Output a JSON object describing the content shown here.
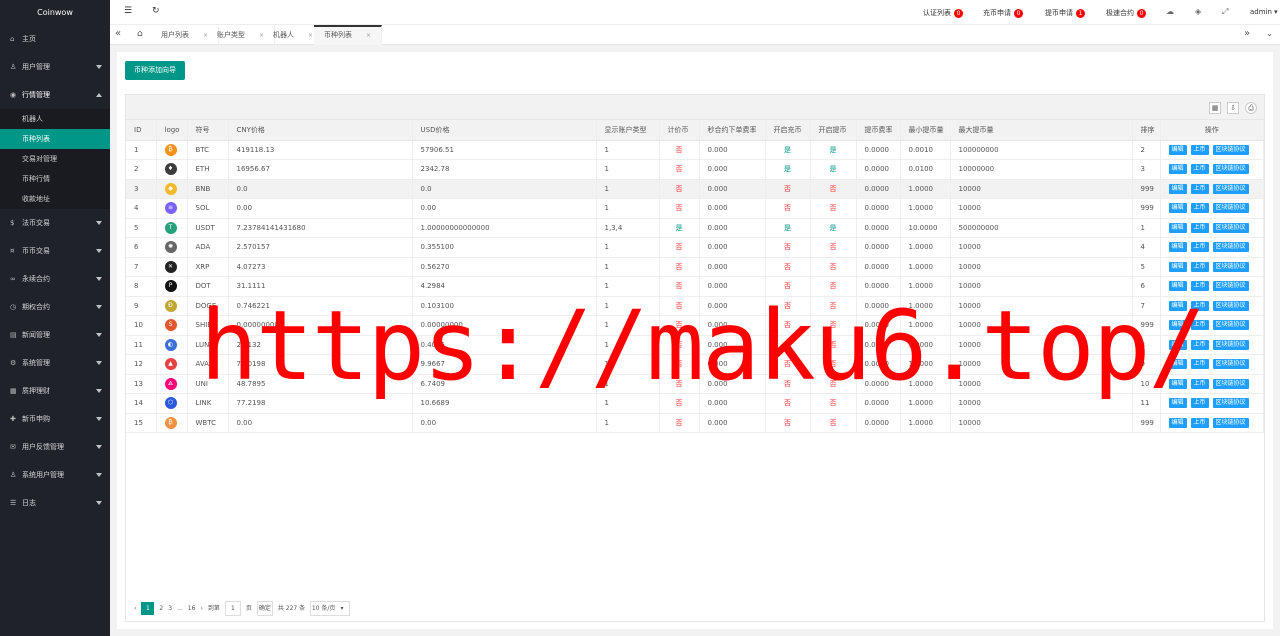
{
  "app": {
    "title": "Coinwow"
  },
  "sidebar": {
    "items": [
      {
        "icon": "home-icon",
        "glyph": "⌂",
        "label": "主页",
        "caret": false
      },
      {
        "icon": "user-icon",
        "glyph": "♙",
        "label": "用户管理",
        "caret": true
      },
      {
        "icon": "market-icon",
        "glyph": "◉",
        "label": "行情管理",
        "caret": true,
        "open": true
      },
      {
        "icon": "fiat-icon",
        "glyph": "$",
        "label": "法币交易",
        "caret": true
      },
      {
        "icon": "coin-trade-icon",
        "glyph": "¤",
        "label": "币币交易",
        "caret": true
      },
      {
        "icon": "perpetual-icon",
        "glyph": "∞",
        "label": "永续合约",
        "caret": true
      },
      {
        "icon": "options-icon",
        "glyph": "◷",
        "label": "期权合约",
        "caret": true
      },
      {
        "icon": "news-icon",
        "glyph": "▤",
        "label": "新闻管理",
        "caret": true
      },
      {
        "icon": "gear-icon",
        "glyph": "⚙",
        "label": "系统管理",
        "caret": true
      },
      {
        "icon": "finance-icon",
        "glyph": "▦",
        "label": "质押理财",
        "caret": true
      },
      {
        "icon": "subscribe-icon",
        "glyph": "✚",
        "label": "新币申购",
        "caret": true
      },
      {
        "icon": "feedback-icon",
        "glyph": "✉",
        "label": "用户反馈管理",
        "caret": true
      },
      {
        "icon": "sysuser-icon",
        "glyph": "♙",
        "label": "系统用户管理",
        "caret": true
      },
      {
        "icon": "log-icon",
        "glyph": "☰",
        "label": "日志",
        "caret": true
      }
    ],
    "submenu": [
      "机器人",
      "币种列表",
      "交易对管理",
      "币种行情",
      "收款地址"
    ],
    "active_sub": 1
  },
  "header": {
    "links": [
      {
        "label": "认证列表",
        "badge": "0"
      },
      {
        "label": "充币申请",
        "badge": "0"
      },
      {
        "label": "提币申请",
        "badge": "1"
      },
      {
        "label": "极速合约",
        "badge": "0"
      }
    ],
    "user": "admin"
  },
  "tabs": [
    {
      "label": "用户列表",
      "active": false
    },
    {
      "label": "账户类型",
      "active": false
    },
    {
      "label": "机器人",
      "active": false
    },
    {
      "label": "币种列表",
      "active": true
    }
  ],
  "main": {
    "add_button": "币种添加向导",
    "columns": [
      "ID",
      "logo",
      "符号",
      "CNY价格",
      "USD价格",
      "显示账户类型",
      "计价币",
      "秒合约下单费率",
      "开启充币",
      "开启提币",
      "提币费率",
      "最小提币量",
      "最大提币量",
      "排序",
      "操作"
    ],
    "row_actions": [
      "编辑",
      "上币",
      "区块链协议"
    ],
    "rows": [
      {
        "id": "1",
        "symbol": "BTC",
        "logo_color": "#f7931a",
        "logo_glyph": "₿",
        "cny": "419118.13",
        "usd": "57906.51",
        "acct": "1",
        "quote": "否",
        "fee": "0.000",
        "deposit": "是",
        "withdraw": "是",
        "wfee": "0.0000",
        "min": "0.0010",
        "max": "100000000",
        "sort": "2"
      },
      {
        "id": "2",
        "symbol": "ETH",
        "logo_color": "#3c3c3d",
        "logo_glyph": "♦",
        "cny": "16956.67",
        "usd": "2342.78",
        "acct": "1",
        "quote": "否",
        "fee": "0.000",
        "deposit": "是",
        "withdraw": "是",
        "wfee": "0.0000",
        "min": "0.0100",
        "max": "10000000",
        "sort": "3"
      },
      {
        "id": "3",
        "symbol": "BNB",
        "logo_color": "#f3ba2f",
        "logo_glyph": "◆",
        "cny": "0.0",
        "usd": "0.0",
        "acct": "1",
        "quote": "否",
        "fee": "0.000",
        "deposit": "否",
        "withdraw": "否",
        "wfee": "0.0000",
        "min": "1.0000",
        "max": "10000",
        "sort": "999"
      },
      {
        "id": "4",
        "symbol": "SOL",
        "logo_color": "#7b61ff",
        "logo_glyph": "≡",
        "cny": "0.00",
        "usd": "0.00",
        "acct": "1",
        "quote": "否",
        "fee": "0.000",
        "deposit": "否",
        "withdraw": "否",
        "wfee": "0.0000",
        "min": "1.0000",
        "max": "10000",
        "sort": "999"
      },
      {
        "id": "5",
        "symbol": "USDT",
        "logo_color": "#26a17b",
        "logo_glyph": "T",
        "cny": "7.23784141431680",
        "usd": "1.00000000000000",
        "acct": "1,3,4",
        "quote": "是",
        "fee": "0.000",
        "deposit": "是",
        "withdraw": "是",
        "wfee": "0.0000",
        "min": "10.0000",
        "max": "500000000",
        "sort": "1"
      },
      {
        "id": "6",
        "symbol": "ADA",
        "logo_color": "#666666",
        "logo_glyph": "✺",
        "cny": "2.570157",
        "usd": "0.355100",
        "acct": "1",
        "quote": "否",
        "fee": "0.000",
        "deposit": "否",
        "withdraw": "否",
        "wfee": "0.0000",
        "min": "1.0000",
        "max": "10000",
        "sort": "4"
      },
      {
        "id": "7",
        "symbol": "XRP",
        "logo_color": "#222222",
        "logo_glyph": "✕",
        "cny": "4.07273",
        "usd": "0.56270",
        "acct": "1",
        "quote": "否",
        "fee": "0.000",
        "deposit": "否",
        "withdraw": "否",
        "wfee": "0.0000",
        "min": "1.0000",
        "max": "10000",
        "sort": "5"
      },
      {
        "id": "8",
        "symbol": "DOT",
        "logo_color": "#111111",
        "logo_glyph": "P",
        "cny": "31.1111",
        "usd": "4.2984",
        "acct": "1",
        "quote": "否",
        "fee": "0.000",
        "deposit": "否",
        "withdraw": "否",
        "wfee": "0.0000",
        "min": "1.0000",
        "max": "10000",
        "sort": "6"
      },
      {
        "id": "9",
        "symbol": "DOGE",
        "logo_color": "#c2a633",
        "logo_glyph": "Ð",
        "cny": "0.746221",
        "usd": "0.103100",
        "acct": "1",
        "quote": "否",
        "fee": "0.000",
        "deposit": "否",
        "withdraw": "否",
        "wfee": "0.0000",
        "min": "1.0000",
        "max": "10000",
        "sort": "7"
      },
      {
        "id": "10",
        "symbol": "SHIB",
        "logo_color": "#e4572e",
        "logo_glyph": "S",
        "cny": "0.00000000",
        "usd": "0.00000000",
        "acct": "1",
        "quote": "否",
        "fee": "0.000",
        "deposit": "否",
        "withdraw": "否",
        "wfee": "0.0000",
        "min": "1.0000",
        "max": "10000",
        "sort": "999"
      },
      {
        "id": "11",
        "symbol": "LUNA",
        "logo_color": "#3a6fd8",
        "logo_glyph": "◐",
        "cny": "2.9132",
        "usd": "0.4025",
        "acct": "1",
        "quote": "否",
        "fee": "0.000",
        "deposit": "否",
        "withdraw": "否",
        "wfee": "0.0000",
        "min": "1.0000",
        "max": "10000",
        "sort": "8"
      },
      {
        "id": "12",
        "symbol": "AVAX",
        "logo_color": "#e84142",
        "logo_glyph": "▲",
        "cny": "72.0198",
        "usd": "9.9667",
        "acct": "1",
        "quote": "否",
        "fee": "0.000",
        "deposit": "否",
        "withdraw": "否",
        "wfee": "0.0000",
        "min": "1.0000",
        "max": "10000",
        "sort": "9"
      },
      {
        "id": "13",
        "symbol": "UNI",
        "logo_color": "#ff007a",
        "logo_glyph": "🜁",
        "cny": "48.7895",
        "usd": "6.7409",
        "acct": "1",
        "quote": "否",
        "fee": "0.000",
        "deposit": "否",
        "withdraw": "否",
        "wfee": "0.0000",
        "min": "1.0000",
        "max": "10000",
        "sort": "10"
      },
      {
        "id": "14",
        "symbol": "LINK",
        "logo_color": "#2a5ada",
        "logo_glyph": "⬡",
        "cny": "77.2198",
        "usd": "10.6689",
        "acct": "1",
        "quote": "否",
        "fee": "0.000",
        "deposit": "否",
        "withdraw": "否",
        "wfee": "0.0000",
        "min": "1.0000",
        "max": "10000",
        "sort": "11"
      },
      {
        "id": "15",
        "symbol": "WBTC",
        "logo_color": "#f09242",
        "logo_glyph": "₿",
        "cny": "0.00",
        "usd": "0.00",
        "acct": "1",
        "quote": "否",
        "fee": "0.000",
        "deposit": "否",
        "withdraw": "否",
        "wfee": "0.0000",
        "min": "1.0000",
        "max": "10000",
        "sort": "999"
      }
    ],
    "highlight_row": 2
  },
  "pager": {
    "pages": [
      "1",
      "2",
      "3",
      "...",
      "16"
    ],
    "current": "1",
    "goto_label": "到第",
    "goto_value": "1",
    "goto_unit": "页",
    "confirm": "确定",
    "total": "共 227 条",
    "per_page": "10 条/页"
  },
  "watermark": {
    "text": "https://maku6.top/"
  }
}
